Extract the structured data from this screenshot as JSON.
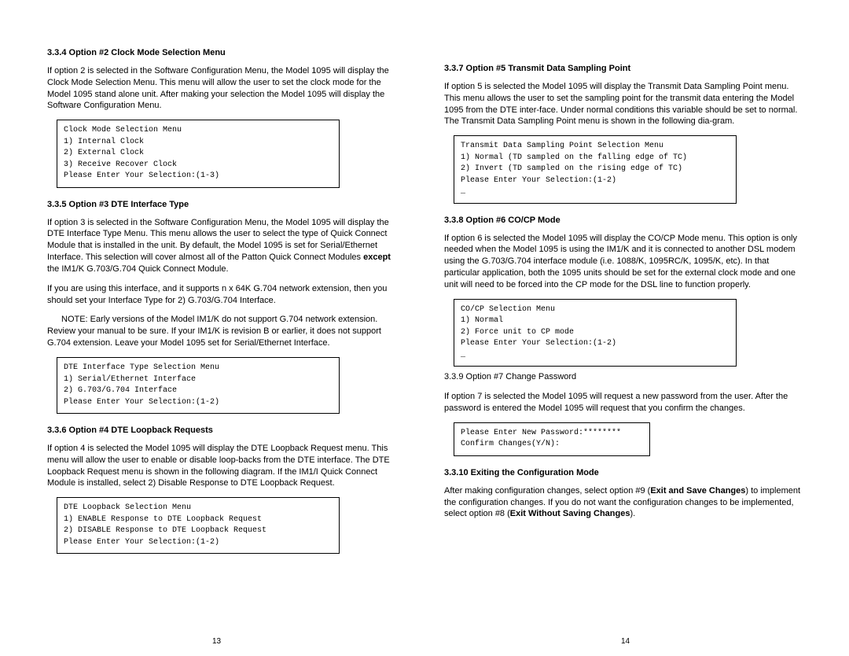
{
  "left": {
    "h1": "3.3.4 Option #2 Clock Mode Selection Menu",
    "p1": "If option 2 is selected in the Software Configuration Menu, the Model 1095 will display the Clock Mode Selection Menu. This menu will allow the user to set the clock mode for the Model 1095 stand alone unit. After making your selection the Model 1095 will display the Software Configuration Menu.",
    "menu1": "Clock Mode Selection Menu\n1) Internal Clock\n2) External Clock\n3) Receive Recover Clock\nPlease Enter Your Selection:(1-3)",
    "h2": "3.3.5 Option #3 DTE Interface Type",
    "p2a": "If option 3 is selected in the Software Configuration Menu, the Model 1095 will display the DTE Interface Type Menu. This menu allows the user to select the type of Quick Connect Module that is installed in the unit. By default, the Model 1095 is set for Serial/Ethernet Interface. This selection will cover almost all of the Patton Quick Connect Modules ",
    "p2a_bold": "except",
    "p2a_tail": " the IM1/K G.703/G.704 Quick Connect Module.",
    "p2b": "If you are using this interface, and it supports n x 64K G.704 network extension, then you should set your Interface Type for 2) G.703/G.704 Interface.",
    "p2c": "NOTE: Early versions of the Model IM1/K do not support G.704 network extension. Review your manual to be sure. If your IM1/K is revision B or earlier, it does not support G.704 extension. Leave your Model 1095 set for Serial/Ethernet Interface.",
    "menu2": "DTE Interface Type Selection Menu\n1) Serial/Ethernet Interface\n2) G.703/G.704 Interface\nPlease Enter Your Selection:(1-2)",
    "h3": "3.3.6 Option #4 DTE Loopback Requests",
    "p3": "If option 4 is selected the Model 1095 will display the DTE Loopback Request menu. This menu will allow the user to enable or disable loop-backs from the DTE interface. The DTE Loopback Request menu is shown in the following diagram. If the IM1/I Quick Connect Module is installed, select 2) Disable Response to DTE Loopback Request.",
    "menu3": "DTE Loopback Selection Menu\n1) ENABLE Response to DTE Loopback Request\n2) DISABLE Response to DTE Loopback Request\nPlease Enter Your Selection:(1-2)",
    "pageno": "13"
  },
  "right": {
    "h1": "3.3.7 Option #5 Transmit Data Sampling Point",
    "p1": "If option 5 is selected the Model 1095 will display the Transmit Data Sampling Point menu. This menu allows the user to set the sampling point for the transmit data entering the Model 1095 from the DTE inter-face. Under normal conditions this variable should be set to normal. The Transmit Data Sampling Point menu is shown in the following dia-gram.",
    "menu1": "Transmit Data Sampling Point Selection Menu\n1) Normal (TD sampled on the falling edge of TC)\n2) Invert (TD sampled on the rising edge of TC)\nPlease Enter Your Selection:(1-2)\n_",
    "h2": "3.3.8 Option #6 CO/CP Mode",
    "p2": "If option 6 is selected the Model 1095 will display the CO/CP Mode menu. This option is only needed when the Model 1095 is using the IM1/K and it is connected to another DSL modem using the G.703/G.704 interface module (i.e. 1088/K, 1095RC/K, 1095/K, etc). In that particular application, both the 1095 units should be set for the external clock mode and one unit will need to be forced into the CP mode for the DSL line to function properly.",
    "menu2": "CO/CP Selection Menu\n1) Normal\n2) Force unit to CP mode\nPlease Enter Your Selection:(1-2)\n_",
    "h3": "3.3.9 Option #7 Change Password",
    "p3": "If option 7 is selected the Model 1095 will request a new password from the user. After the password is entered the Model 1095 will request that you confirm the changes.",
    "menu3": "Please Enter New Password:********\nConfirm Changes(Y/N):",
    "h4": "3.3.10 Exiting the Configuration Mode",
    "p4a": "After making configuration changes, select option #9 (",
    "p4a_bold": "Exit and Save Changes",
    "p4a_tail": ") to implement the configuration changes. If you do not want the configuration changes to be implemented, select option #8 (",
    "p4b_bold": "Exit Without Saving Changes",
    "p4b_tail": ").",
    "pageno": "14"
  }
}
